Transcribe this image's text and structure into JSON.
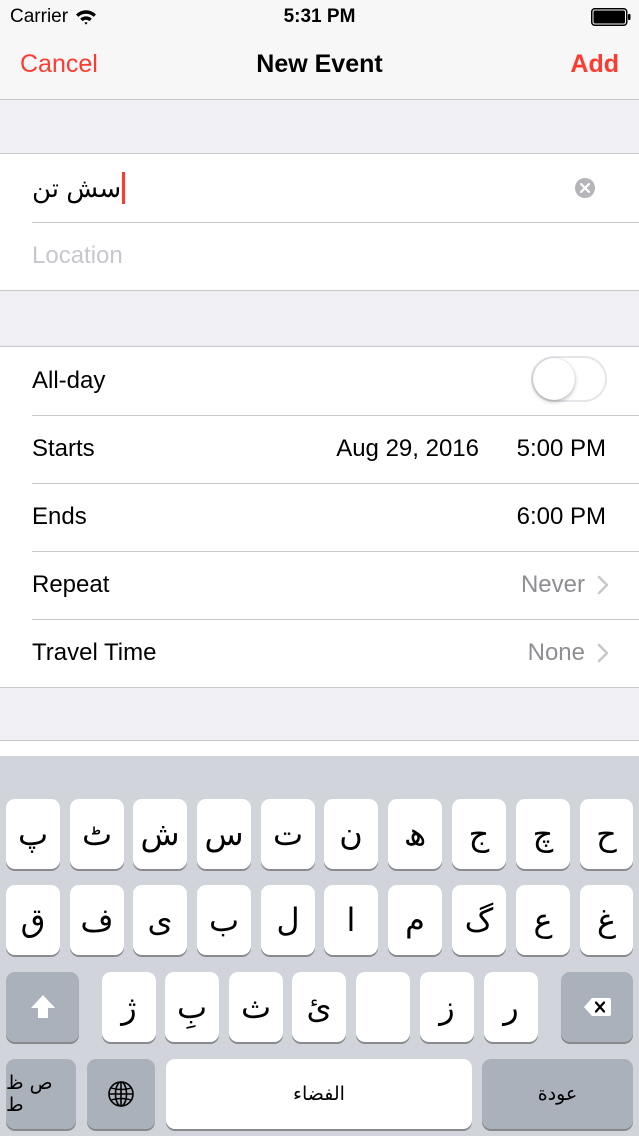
{
  "status_bar": {
    "carrier": "Carrier",
    "time": "5:31 PM"
  },
  "nav": {
    "cancel_label": "Cancel",
    "title": "New Event",
    "add_label": "Add"
  },
  "event": {
    "title_value": "سش تن",
    "location_placeholder": "Location"
  },
  "schedule": {
    "all_day_label": "All-day",
    "all_day_on": false,
    "starts_label": "Starts",
    "starts_date": "Aug 29, 2016",
    "starts_time": "5:00 PM",
    "ends_label": "Ends",
    "ends_time": "6:00 PM",
    "repeat_label": "Repeat",
    "repeat_value": "Never",
    "travel_label": "Travel Time",
    "travel_value": "None"
  },
  "keyboard": {
    "row1": [
      "ح",
      "چ",
      "ج",
      "ھ",
      "ن",
      "ت",
      "س",
      "ش",
      "ٹ",
      "پ"
    ],
    "row2": [
      "غ",
      "ع",
      "گ",
      "م",
      "ا",
      "ل",
      "ب",
      "ی",
      "ف",
      "ق"
    ],
    "row3": [
      "ر",
      "ز",
      "",
      "ئ",
      "ث",
      "بِ",
      "ژ"
    ],
    "alt_label": "ص ظ ط",
    "space_label": "الفضاء",
    "return_label": "عودة"
  },
  "colors": {
    "accent": "#ff3b30",
    "secondary_text": "#8e8e93",
    "placeholder": "#c7c7cd",
    "keyboard_bg": "#d1d5db",
    "dark_key": "#abb1ba"
  }
}
